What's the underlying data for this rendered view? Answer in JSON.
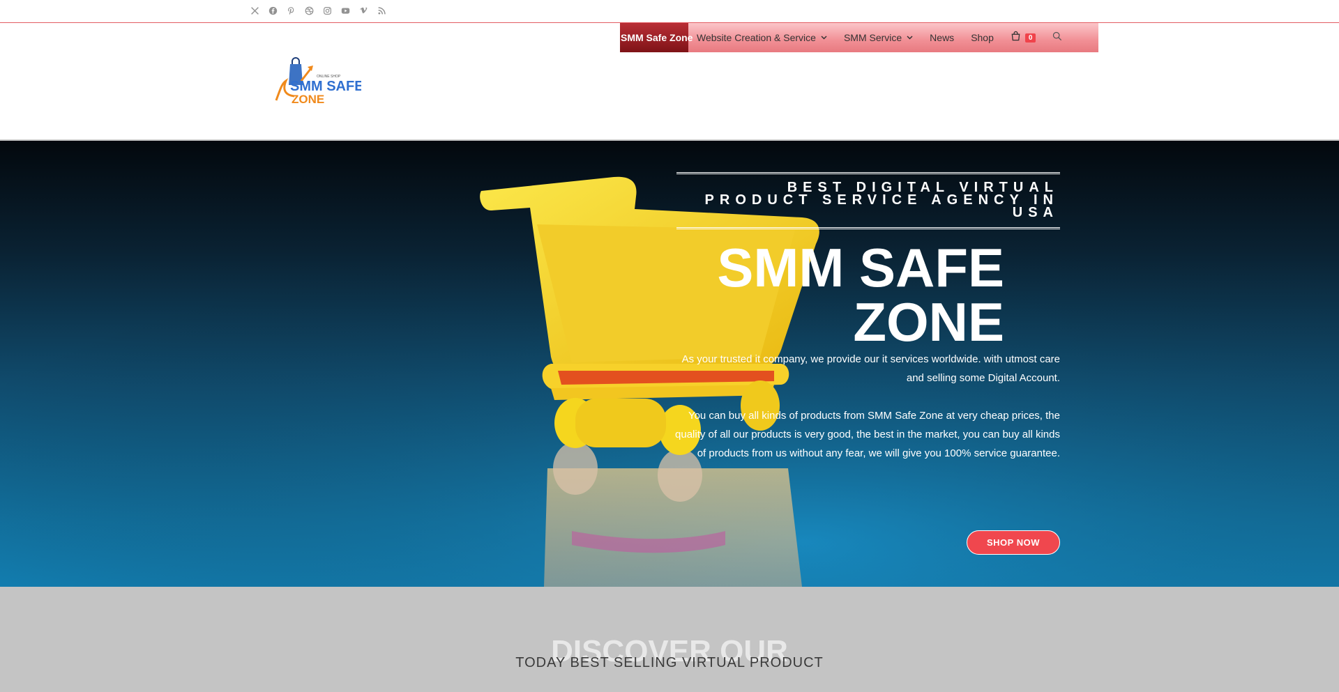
{
  "social": [
    "x-icon",
    "facebook-icon",
    "pinterest-icon",
    "dribbble-icon",
    "instagram-icon",
    "youtube-icon",
    "vimeo-icon",
    "rss-icon"
  ],
  "nav": {
    "items": [
      {
        "label": "SMM Safe Zone",
        "active": true,
        "dropdown": false
      },
      {
        "label": "Website Creation & Service",
        "active": false,
        "dropdown": true
      },
      {
        "label": "SMM Service",
        "active": false,
        "dropdown": true
      },
      {
        "label": "News",
        "active": false,
        "dropdown": false
      },
      {
        "label": "Shop",
        "active": false,
        "dropdown": false
      }
    ],
    "cart_count": "0"
  },
  "logo": {
    "line1": "SMM SAFE",
    "line2": "ZONE",
    "tagline": "ONLINE SHOP"
  },
  "hero": {
    "eyebrow_lines": [
      "BEST DIGITAL VIRTUAL",
      "PRODUCT SERVICE AGENCY IN",
      "USA"
    ],
    "title_line1": "SMM SAFE",
    "title_line2": "ZONE",
    "paragraph1": "As your trusted it company, we provide our it services worldwide. with utmost care and selling some Digital Account.",
    "paragraph2": "You can buy all kinds of products from SMM Safe Zone at very cheap prices, the quality of all our products is very good, the best in the market, you can buy all kinds of products from us without any fear, we will give you 100% service guarantee.",
    "cta": "SHOP NOW"
  },
  "discover": {
    "heading": "DISCOVER OUR",
    "subheading": "TODAY BEST SELLING VIRTUAL PRODUCT"
  },
  "colors": {
    "accent": "#f0474e",
    "nav_active": "#9a1f25",
    "hero_dark": "#03080d",
    "hero_blue": "#1385ba",
    "cart_yellow": "#f5d61e"
  }
}
